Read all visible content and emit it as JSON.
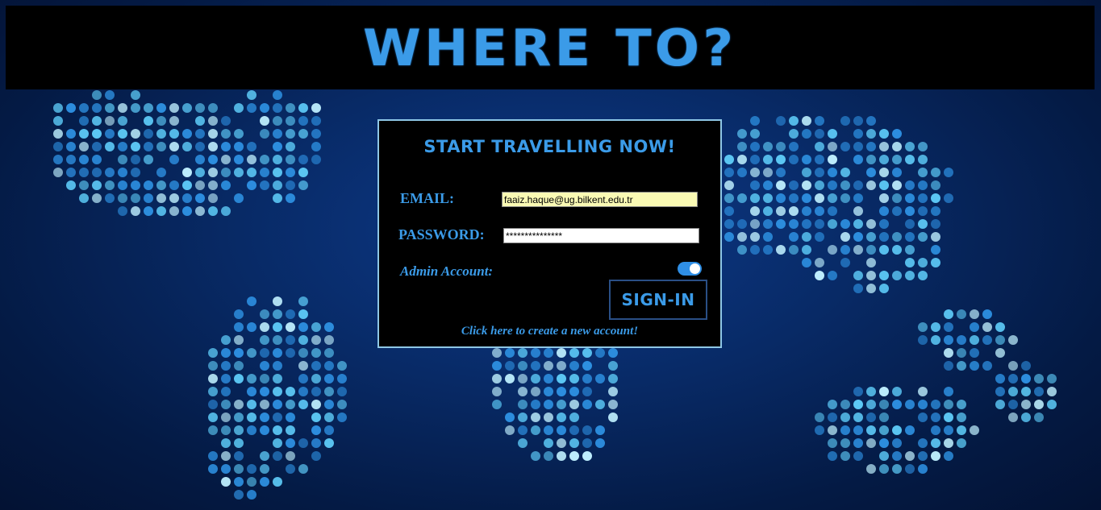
{
  "header": {
    "title": "WHERE TO?"
  },
  "login": {
    "heading": "START TRAVELLING NOW!",
    "email_label": "EMAIL:",
    "email_value": "faaiz.haque@ug.bilkent.edu.tr",
    "password_label": "PASSWORD:",
    "password_value": "***************",
    "admin_label": "Admin Account:",
    "admin_enabled": true,
    "signin_label": "SIGN-IN",
    "create_account_link": "Click here to create a new account!"
  },
  "colors": {
    "accent": "#3b9be8",
    "panel_border": "#8ec7e6",
    "email_field_bg": "#fafab4",
    "toggle_on": "#2f8fe6"
  },
  "icons": {
    "background": "world-map-dots-icon"
  }
}
